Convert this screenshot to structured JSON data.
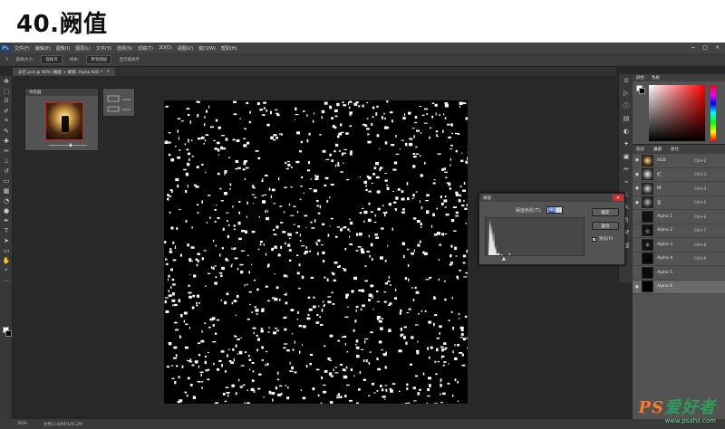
{
  "heading": "40.阙值",
  "app": {
    "logo": "Ps"
  },
  "menubar": {
    "items": [
      "文件(F)",
      "编辑(E)",
      "图像(I)",
      "图层(L)",
      "文字(Y)",
      "选择(S)",
      "滤镜(T)",
      "3D(D)",
      "视图(V)",
      "窗口(W)",
      "帮助(H)"
    ],
    "controls": [
      "−",
      "□",
      "×"
    ]
  },
  "options": {
    "size_label": "取样大小:",
    "size_value": "取样点",
    "sample_label": "样本:",
    "sample_value": "所有图层",
    "show_ring": "显示取样环"
  },
  "document": {
    "tab_label": "光芒.psd @ 80% (魔鹿 + 蒙版, Alpha 6/8) *",
    "tab_close": "×",
    "zoom": "80%",
    "file_info": "文档:2.84M/105.2M"
  },
  "navigator": {
    "title": "导航器"
  },
  "color_panel": {
    "tabs": [
      "颜色",
      "色板"
    ]
  },
  "channels": {
    "tabs": [
      "图层",
      "通道",
      "路径"
    ],
    "rows": [
      {
        "name": "RGB",
        "key": "Ctrl+2"
      },
      {
        "name": "红",
        "key": "Ctrl+3"
      },
      {
        "name": "绿",
        "key": "Ctrl+4"
      },
      {
        "name": "蓝",
        "key": "Ctrl+5"
      },
      {
        "name": "Alpha 1",
        "key": "Ctrl+6"
      },
      {
        "name": "Alpha 2",
        "key": "Ctrl+7"
      },
      {
        "name": "Alpha 3",
        "key": "Ctrl+8"
      },
      {
        "name": "Alpha 4",
        "key": "Ctrl+9"
      },
      {
        "name": "Alpha 5",
        "key": ""
      },
      {
        "name": "Alpha 6",
        "key": ""
      }
    ]
  },
  "threshold_dialog": {
    "title": "阈值",
    "close": "×",
    "level_label": "阈值色阶(T):",
    "level_value": "40",
    "ok": "确定",
    "reset": "复位",
    "preview_label": "预览(P)",
    "preview_checked": "✔"
  },
  "watermark": {
    "logo_a": "PS",
    "logo_b": "爱好者",
    "url": "www.psahz.com"
  }
}
